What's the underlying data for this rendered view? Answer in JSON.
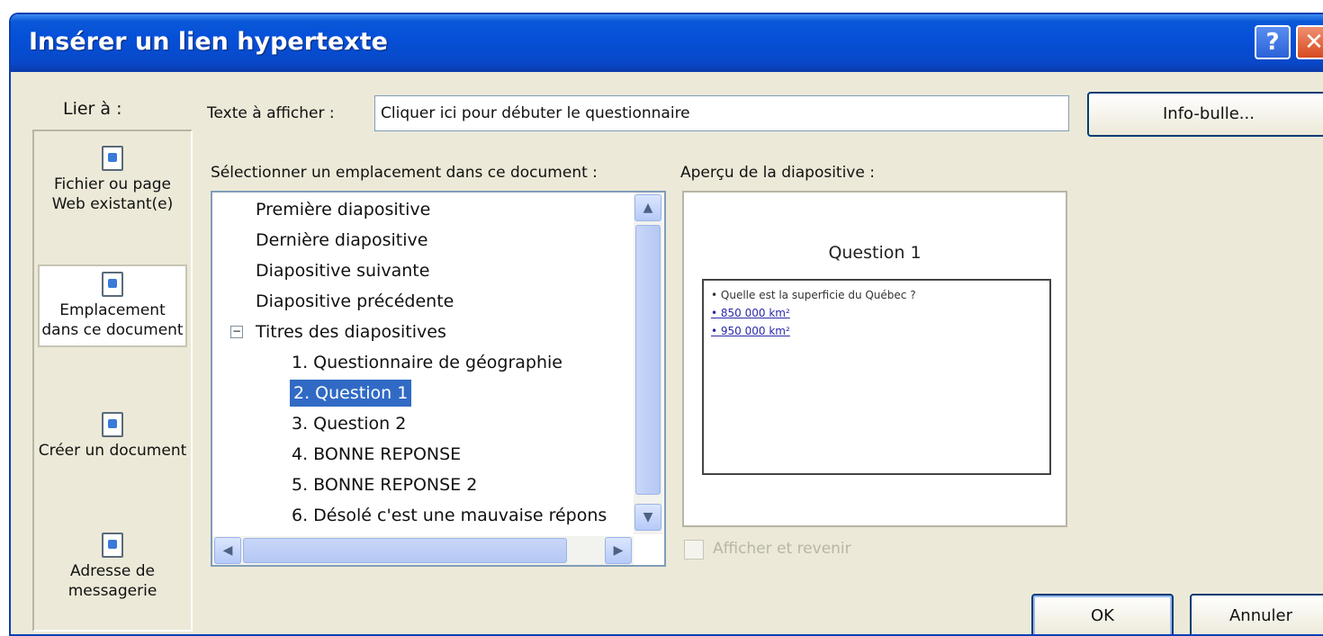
{
  "window": {
    "title": "Insérer un lien hypertexte",
    "help_glyph": "?",
    "close_glyph": "✕"
  },
  "link_to": {
    "label": "Lier à :",
    "items": [
      {
        "label": "Fichier ou page Web existant(e)",
        "icon": "web-page-icon",
        "selected": false
      },
      {
        "label": "Emplacement dans ce document",
        "icon": "document-place-icon",
        "selected": true
      },
      {
        "label": "Créer un document",
        "icon": "new-document-icon",
        "selected": false
      },
      {
        "label": "Adresse de messagerie",
        "icon": "email-icon",
        "selected": false
      }
    ]
  },
  "text_to_display": {
    "label": "Texte à afficher :",
    "value": "Cliquer ici pour débuter le questionnaire"
  },
  "infobulle_button": "Info-bulle...",
  "select_place": {
    "label": "Sélectionner un emplacement dans ce document :",
    "items": [
      "Première diapositive",
      "Dernière diapositive",
      "Diapositive suivante",
      "Diapositive précédente",
      "Titres des diapositives",
      "1. Questionnaire de géographie",
      "2. Question 1",
      "3. Question 2",
      "4. BONNE REPONSE",
      "5. BONNE REPONSE 2",
      "6. Désolé c'est une mauvaise répons"
    ],
    "selected_item": "2. Question 1",
    "collapse_glyph": "−"
  },
  "preview": {
    "label": "Aperçu de la diapositive :",
    "slide_title": "Question 1",
    "bullets": [
      "• Quelle est la superficie du Québec ?"
    ],
    "links": [
      "• 850 000 km²",
      "• 950 000 km²"
    ]
  },
  "show_return": {
    "label": "Afficher et revenir",
    "checked": false
  },
  "buttons": {
    "ok": "OK",
    "cancel": "Annuler"
  }
}
